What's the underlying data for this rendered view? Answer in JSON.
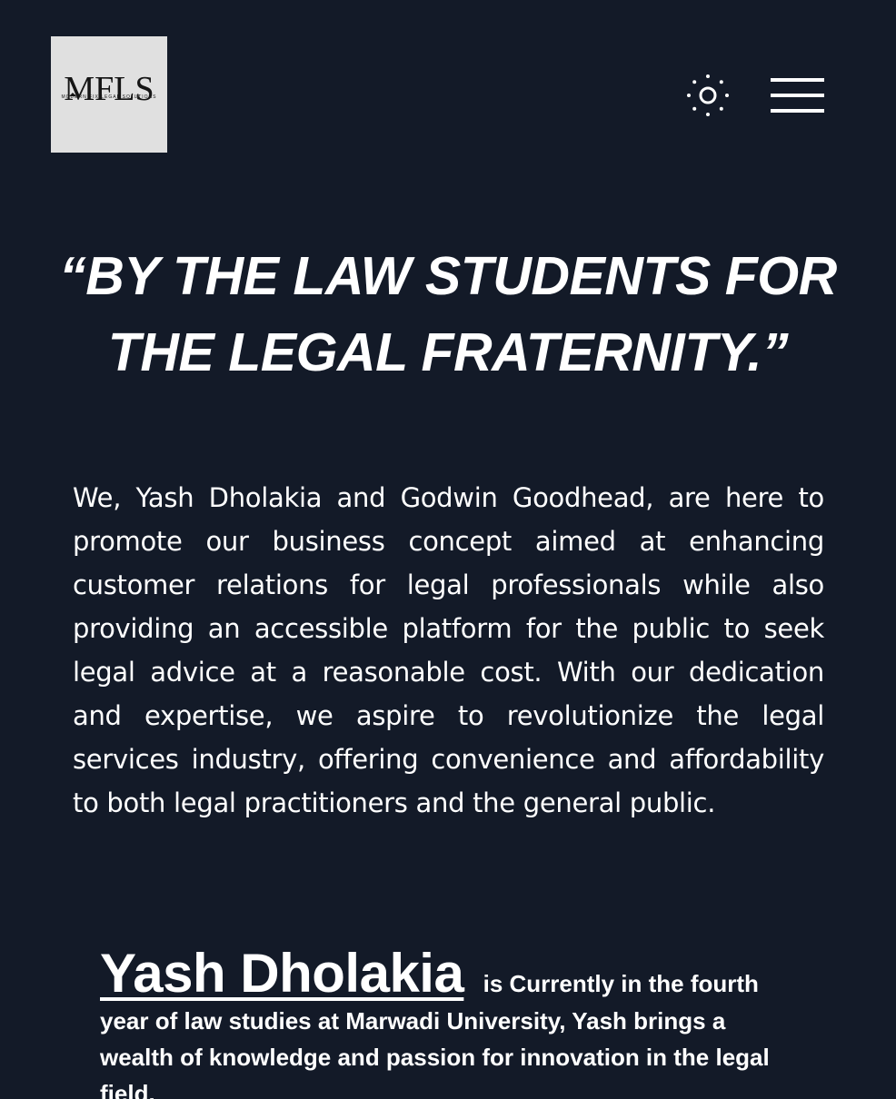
{
  "header": {
    "logo_text": "MFLS",
    "logo_subtext": "MODERN FIX LEGAL SOLUTIONS",
    "theme_toggle_icon": "sun-icon",
    "menu_icon": "hamburger-menu-icon"
  },
  "hero": {
    "tagline": "“BY THE LAW STUDENTS FOR THE LEGAL FRATERNITY.”"
  },
  "about": {
    "intro": "We, Yash Dholakia and Godwin Goodhead, are here to promote our business concept aimed at enhancing customer relations for legal professionals while also providing an accessible platform for the public to seek legal advice at a reasonable cost. With our dedication and expertise, we aspire to revolutionize the legal services industry, offering convenience and affordability to both legal practitioners and the general public."
  },
  "founders": [
    {
      "name": "Yash Dholakia",
      "bio": "is Currently in the fourth year of law studies at Marwadi University, Yash brings a wealth of knowledge and passion for innovation in the legal field."
    }
  ],
  "colors": {
    "background": "#131a28",
    "text": "#ffffff",
    "logo_background": "#e0e0e0"
  }
}
